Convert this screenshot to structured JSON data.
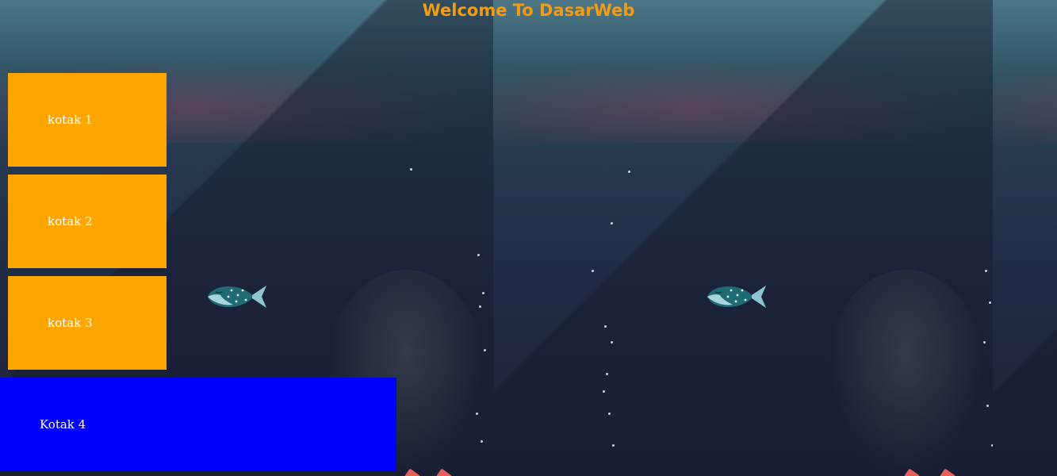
{
  "page": {
    "title": "Welcome To DasarWeb"
  },
  "boxes": {
    "kotak1": "kotak 1",
    "kotak2": "kotak 2",
    "kotak3": "kotak 3",
    "kotak4": "Kotak 4"
  },
  "colors": {
    "title": "#f39c12",
    "orange_box": "#ffa500",
    "blue_box": "#0000ff",
    "box_text": "#ffffff"
  },
  "background": {
    "description_icon": "underwater-fish-background"
  }
}
